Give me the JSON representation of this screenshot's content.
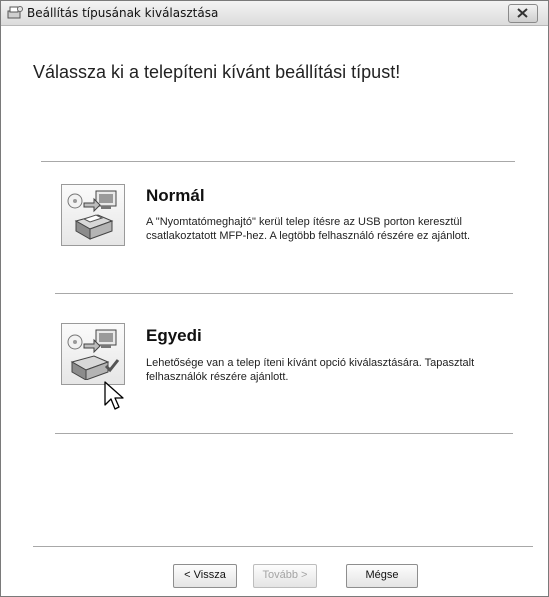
{
  "window": {
    "title": "Beállítás típusának kiválasztása",
    "heading": "Válassza ki a telepíteni kívánt beállítási típust!"
  },
  "options": [
    {
      "title": "Normál",
      "description_line1": "A \"Nyomtatómeghajtó\" kerül telep ítésre az USB porton keresztül",
      "description_line2": "csatlakoztatott MFP-hez. A legtöbb felhasználó részére ez ajánlott.",
      "icon": "printer-install-icon"
    },
    {
      "title": "Egyedi",
      "description_line1": "Lehetősége van a telep íteni kívánt opció kiválasztására. Tapasztalt",
      "description_line2": "felhasználók részére ajánlott.",
      "icon": "printer-custom-install-icon"
    }
  ],
  "buttons": {
    "back": "< Vissza",
    "next": "Tovább >",
    "cancel": "Mégse"
  },
  "colors": {
    "titlebar": "#dcdcdc",
    "disabled_text": "#a4a4a4"
  }
}
